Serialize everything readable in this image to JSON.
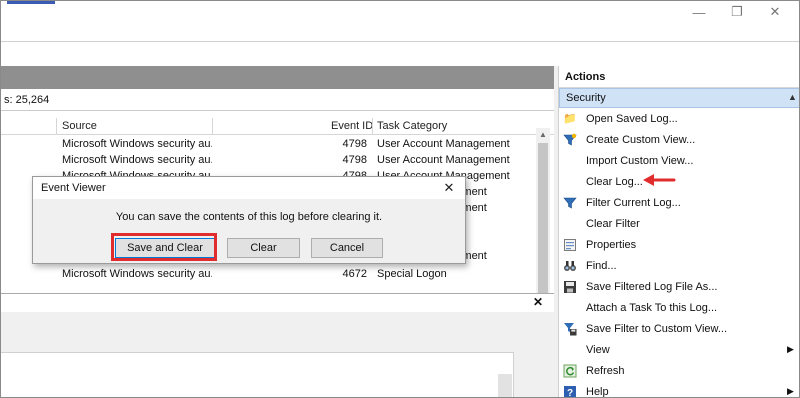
{
  "window": {
    "controls": {
      "minimize": "—",
      "maximize": "❐",
      "close": "✕"
    }
  },
  "log": {
    "count_text": "s: 25,264",
    "columns": {
      "source": "Source",
      "event_id": "Event ID",
      "task_category": "Task Category"
    },
    "rows": [
      {
        "source": "Microsoft Windows security au...",
        "event_id": "4798",
        "task": "User Account Management"
      },
      {
        "source": "Microsoft Windows security au...",
        "event_id": "4798",
        "task": "User Account Management"
      },
      {
        "source": "Microsoft Windows security au...",
        "event_id": "4798",
        "task": "User Account Management"
      },
      {
        "source": "",
        "event_id": "",
        "task": "...gement"
      },
      {
        "source": "",
        "event_id": "",
        "task": "...gement"
      },
      {
        "source": "",
        "event_id": "",
        "task": ""
      },
      {
        "source": "",
        "event_id": "",
        "task": ""
      },
      {
        "source": "",
        "event_id": "",
        "task": "...gement"
      },
      {
        "source": "Microsoft Windows security au...",
        "event_id": "4672",
        "task": "Special Logon"
      }
    ],
    "details_close": "✕"
  },
  "actions": {
    "title": "Actions",
    "section": "Security",
    "items": [
      {
        "label": "Open Saved Log...",
        "icon": "folder-icon"
      },
      {
        "label": "Create Custom View...",
        "icon": "funnel-icon"
      },
      {
        "label": "Import Custom View...",
        "icon": ""
      },
      {
        "label": "Clear Log...",
        "icon": ""
      },
      {
        "label": "Filter Current Log...",
        "icon": "funnel-icon"
      },
      {
        "label": "Clear Filter",
        "icon": ""
      },
      {
        "label": "Properties",
        "icon": "properties-icon"
      },
      {
        "label": "Find...",
        "icon": "binoculars-icon"
      },
      {
        "label": "Save Filtered Log File As...",
        "icon": "save-icon"
      },
      {
        "label": "Attach a Task To this Log...",
        "icon": ""
      },
      {
        "label": "Save Filter to Custom View...",
        "icon": "funnel-save-icon"
      },
      {
        "label": "View",
        "icon": ""
      },
      {
        "label": "Refresh",
        "icon": "refresh-icon"
      },
      {
        "label": "Help",
        "icon": "help-icon"
      }
    ]
  },
  "dialog": {
    "title": "Event Viewer",
    "message": "You can save the contents of this log before clearing it.",
    "buttons": {
      "save_and_clear": "Save and Clear",
      "clear": "Clear",
      "cancel": "Cancel"
    },
    "close": "✕"
  },
  "colors": {
    "highlight": "#e02c2c",
    "section_bg": "#cfe2f6",
    "header_grey": "#8f8f8f"
  }
}
